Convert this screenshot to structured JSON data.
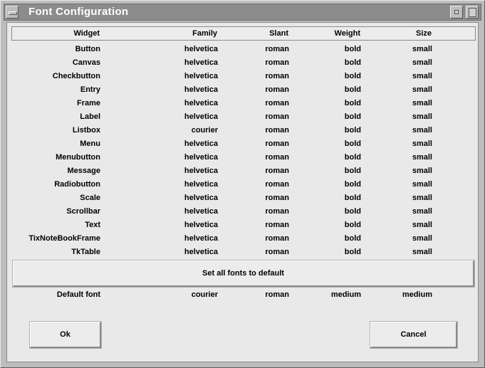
{
  "window": {
    "title": "Font Configuration"
  },
  "table": {
    "headers": {
      "widget": "Widget",
      "family": "Family",
      "slant": "Slant",
      "weight": "Weight",
      "size": "Size"
    },
    "rows": [
      {
        "widget": "Button",
        "family": "helvetica",
        "slant": "roman",
        "weight": "bold",
        "size": "small"
      },
      {
        "widget": "Canvas",
        "family": "helvetica",
        "slant": "roman",
        "weight": "bold",
        "size": "small"
      },
      {
        "widget": "Checkbutton",
        "family": "helvetica",
        "slant": "roman",
        "weight": "bold",
        "size": "small"
      },
      {
        "widget": "Entry",
        "family": "helvetica",
        "slant": "roman",
        "weight": "bold",
        "size": "small"
      },
      {
        "widget": "Frame",
        "family": "helvetica",
        "slant": "roman",
        "weight": "bold",
        "size": "small"
      },
      {
        "widget": "Label",
        "family": "helvetica",
        "slant": "roman",
        "weight": "bold",
        "size": "small"
      },
      {
        "widget": "Listbox",
        "family": "courier",
        "slant": "roman",
        "weight": "bold",
        "size": "small"
      },
      {
        "widget": "Menu",
        "family": "helvetica",
        "slant": "roman",
        "weight": "bold",
        "size": "small"
      },
      {
        "widget": "Menubutton",
        "family": "helvetica",
        "slant": "roman",
        "weight": "bold",
        "size": "small"
      },
      {
        "widget": "Message",
        "family": "helvetica",
        "slant": "roman",
        "weight": "bold",
        "size": "small"
      },
      {
        "widget": "Radiobutton",
        "family": "helvetica",
        "slant": "roman",
        "weight": "bold",
        "size": "small"
      },
      {
        "widget": "Scale",
        "family": "helvetica",
        "slant": "roman",
        "weight": "bold",
        "size": "small"
      },
      {
        "widget": "Scrollbar",
        "family": "helvetica",
        "slant": "roman",
        "weight": "bold",
        "size": "small"
      },
      {
        "widget": "Text",
        "family": "helvetica",
        "slant": "roman",
        "weight": "bold",
        "size": "small"
      },
      {
        "widget": "TixNoteBookFrame",
        "family": "helvetica",
        "slant": "roman",
        "weight": "bold",
        "size": "small"
      },
      {
        "widget": "TkTable",
        "family": "helvetica",
        "slant": "roman",
        "weight": "bold",
        "size": "small"
      }
    ]
  },
  "set_default_label": "Set all fonts to default",
  "default_font": {
    "widget": "Default font",
    "family": "courier",
    "slant": "roman",
    "weight": "medium",
    "size": "medium"
  },
  "buttons": {
    "ok": "Ok",
    "cancel": "Cancel"
  }
}
